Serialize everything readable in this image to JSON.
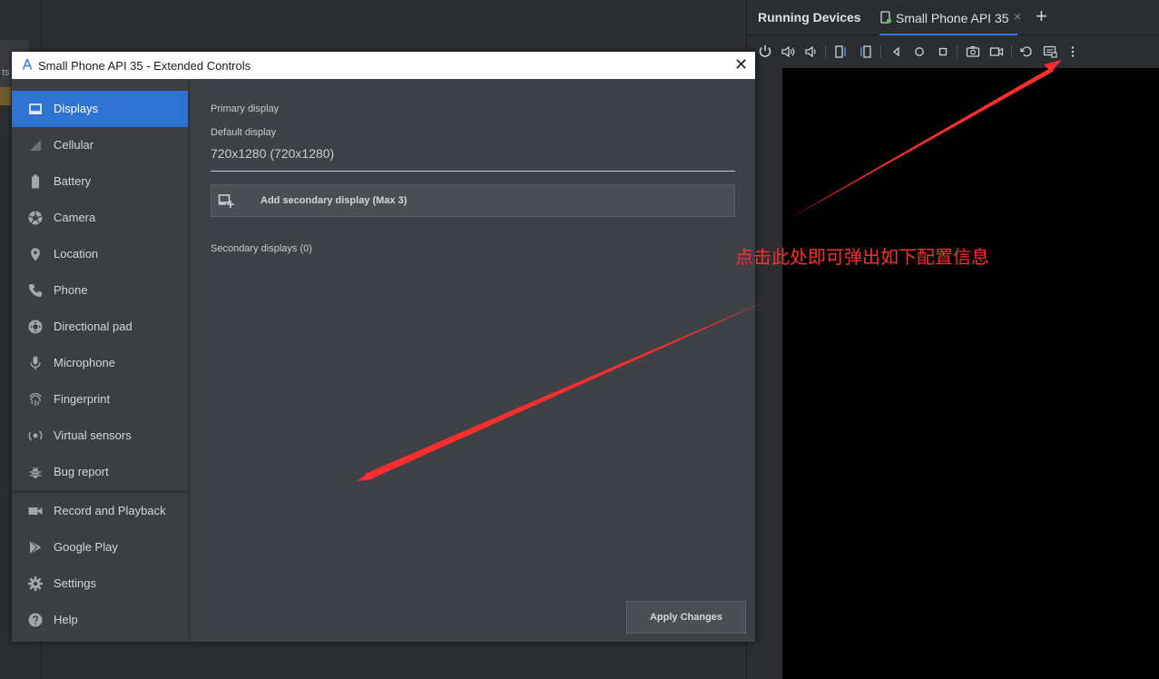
{
  "ide": {
    "left_tab_text": "ts"
  },
  "running_devices": {
    "title": "Running Devices",
    "tab_label": "Small Phone API 35",
    "tab_close": "×",
    "add_tab": "+",
    "toolbar_icons": [
      "power-icon",
      "volume-up-icon",
      "volume-down-icon",
      "rotate-left-icon",
      "rotate-right-icon",
      "back-icon",
      "home-icon",
      "overview-icon",
      "screenshot-icon",
      "screen-record-icon",
      "reset-icon",
      "extended-controls-icon",
      "more-options-icon"
    ]
  },
  "dialog": {
    "title": "Small Phone API 35 - Extended Controls",
    "close": "✕",
    "nav": [
      {
        "label": "Displays",
        "icon": "display-icon",
        "active": true
      },
      {
        "label": "Cellular",
        "icon": "cellular-icon"
      },
      {
        "label": "Battery",
        "icon": "battery-icon"
      },
      {
        "label": "Camera",
        "icon": "camera-icon"
      },
      {
        "label": "Location",
        "icon": "location-icon"
      },
      {
        "label": "Phone",
        "icon": "phone-icon"
      },
      {
        "label": "Directional pad",
        "icon": "dpad-icon"
      },
      {
        "label": "Microphone",
        "icon": "microphone-icon"
      },
      {
        "label": "Fingerprint",
        "icon": "fingerprint-icon"
      },
      {
        "label": "Virtual sensors",
        "icon": "sensors-icon"
      },
      {
        "label": "Bug report",
        "icon": "bug-icon"
      },
      {
        "label": "Record and Playback",
        "icon": "record-icon"
      },
      {
        "label": "Google Play",
        "icon": "play-icon"
      },
      {
        "label": "Settings",
        "icon": "settings-icon"
      },
      {
        "label": "Help",
        "icon": "help-icon"
      }
    ],
    "content": {
      "primary_label": "Primary display",
      "default_label": "Default display",
      "resolution": "720x1280 (720x1280)",
      "add_button": "Add secondary display (Max 3)",
      "secondary_label": "Secondary displays (0)",
      "apply_button": "Apply Changes"
    }
  },
  "annotation": {
    "text": "点击此处即可弹出如下配置信息",
    "color": "#ff2d2d"
  },
  "colors": {
    "accent": "#2e72d2",
    "tab_underline": "#3574f0"
  }
}
